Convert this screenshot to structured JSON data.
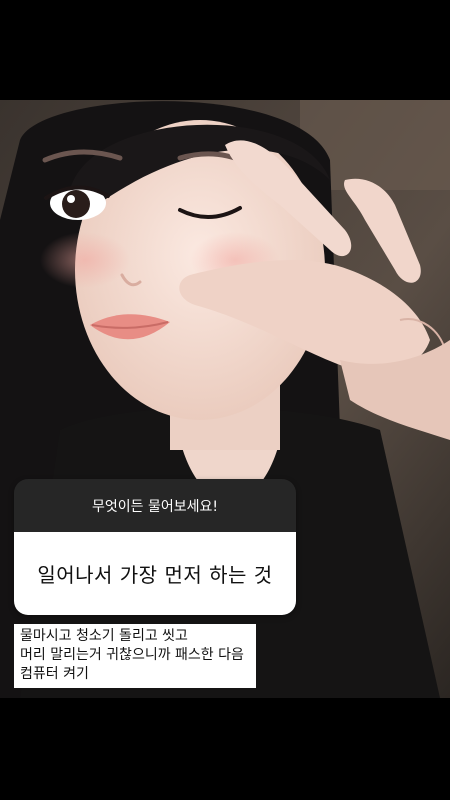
{
  "question_sticker": {
    "prompt": "무엇이든 물어보세요!",
    "question": "일어나서 가장 먼저 하는 것"
  },
  "answer": {
    "lines": [
      "물마시고 청소기 돌리고 씻고",
      "머리 말리는거 귀찮으니까 패스한 다음",
      "컴퓨터 켜기"
    ]
  },
  "colors": {
    "background": "#000000",
    "sticker_header": "#262626",
    "sticker_body": "#ffffff"
  }
}
